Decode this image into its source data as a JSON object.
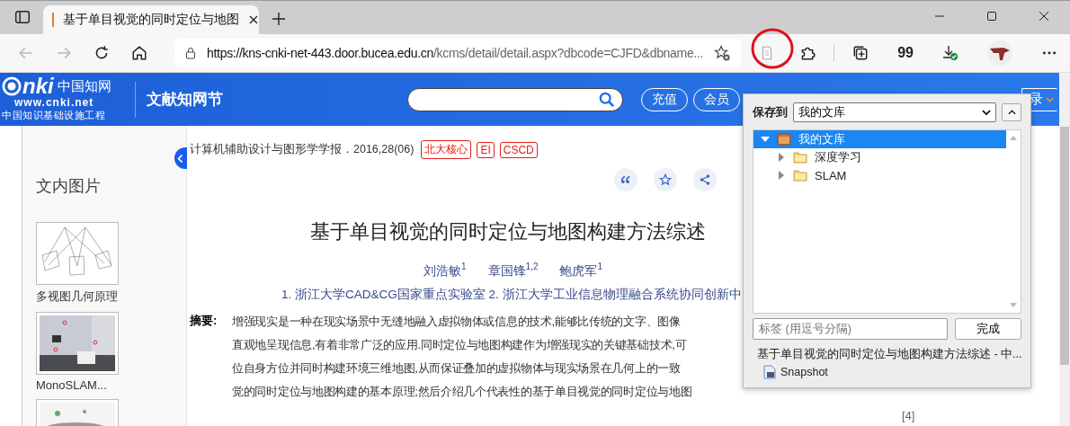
{
  "browser": {
    "tab": {
      "title": "基于单目视觉的同时定位与地图",
      "selected": true
    },
    "url_host": "https://kns-cnki-net-443.door.bucea.edu.cn",
    "url_path": "/kcms/detail/detail.aspx?dbcode=CJFD&dbname...",
    "toolbar_text": "99"
  },
  "site": {
    "logo_mark": "nki",
    "logo_cn": "中国知网",
    "logo_url": "www.cnki.net",
    "logo_slogan": "中国知识基础设施工程",
    "name": "文献知网节",
    "buttons": [
      "充值",
      "会员"
    ],
    "login": "录"
  },
  "sidebar": {
    "title": "文内图片",
    "figures": [
      {
        "kind": "diagram",
        "caption": "多视图几何原理"
      },
      {
        "kind": "picture",
        "caption": "MonoSLAM..."
      },
      {
        "kind": "picture"
      }
    ]
  },
  "article": {
    "source": "计算机辅助设计与图形学学报．2016,28(06)",
    "tags": [
      "北大核心",
      "EI",
      "CSCD"
    ],
    "title": "基于单目视觉的同时定位与地图构建方法综述",
    "authors": [
      {
        "name": "刘浩敏",
        "sup": "1"
      },
      {
        "name": "章国锋",
        "sup": "1,2"
      },
      {
        "name": "鲍虎军",
        "sup": "1"
      }
    ],
    "affiliations": "1. 浙江大学CAD&CG国家重点实验室   2. 浙江大学工业信息物理融合系统协同创新中",
    "abstract_label": "摘要:",
    "abstract_lines": [
      "增强现实是一种在现实场景中无缝地融入虚拟物体或信息的技术,能够比传统的文字、图像",
      "直观地呈现信息,有着非常广泛的应用.同时定位与地图构建作为增强现实的关键基础技术,可",
      "位自身方位并同时构建环境三维地图,从而保证叠加的虚拟物体与现实场景在几何上的一致",
      "觉的同时定位与地图构建的基本原理;然后介绍几个代表性的基于单目视觉的同时定位与地图"
    ],
    "reference_number": "[4]"
  },
  "save_popup": {
    "label": "保存到",
    "folder": "我的文库",
    "tree": [
      {
        "name": "我的文库",
        "selected": true,
        "expanded": true,
        "children": [
          {
            "name": "深度学习",
            "selected": false,
            "expanded": false
          },
          {
            "name": "SLAM",
            "selected": false,
            "expanded": false
          }
        ]
      }
    ],
    "tags_placeholder": "标签 (用逗号分隔)",
    "done_button": "完成",
    "item_title": "基于单目视觉的同时定位与地图构建方法综述 - 中...",
    "snapshot": "Snapshot"
  }
}
